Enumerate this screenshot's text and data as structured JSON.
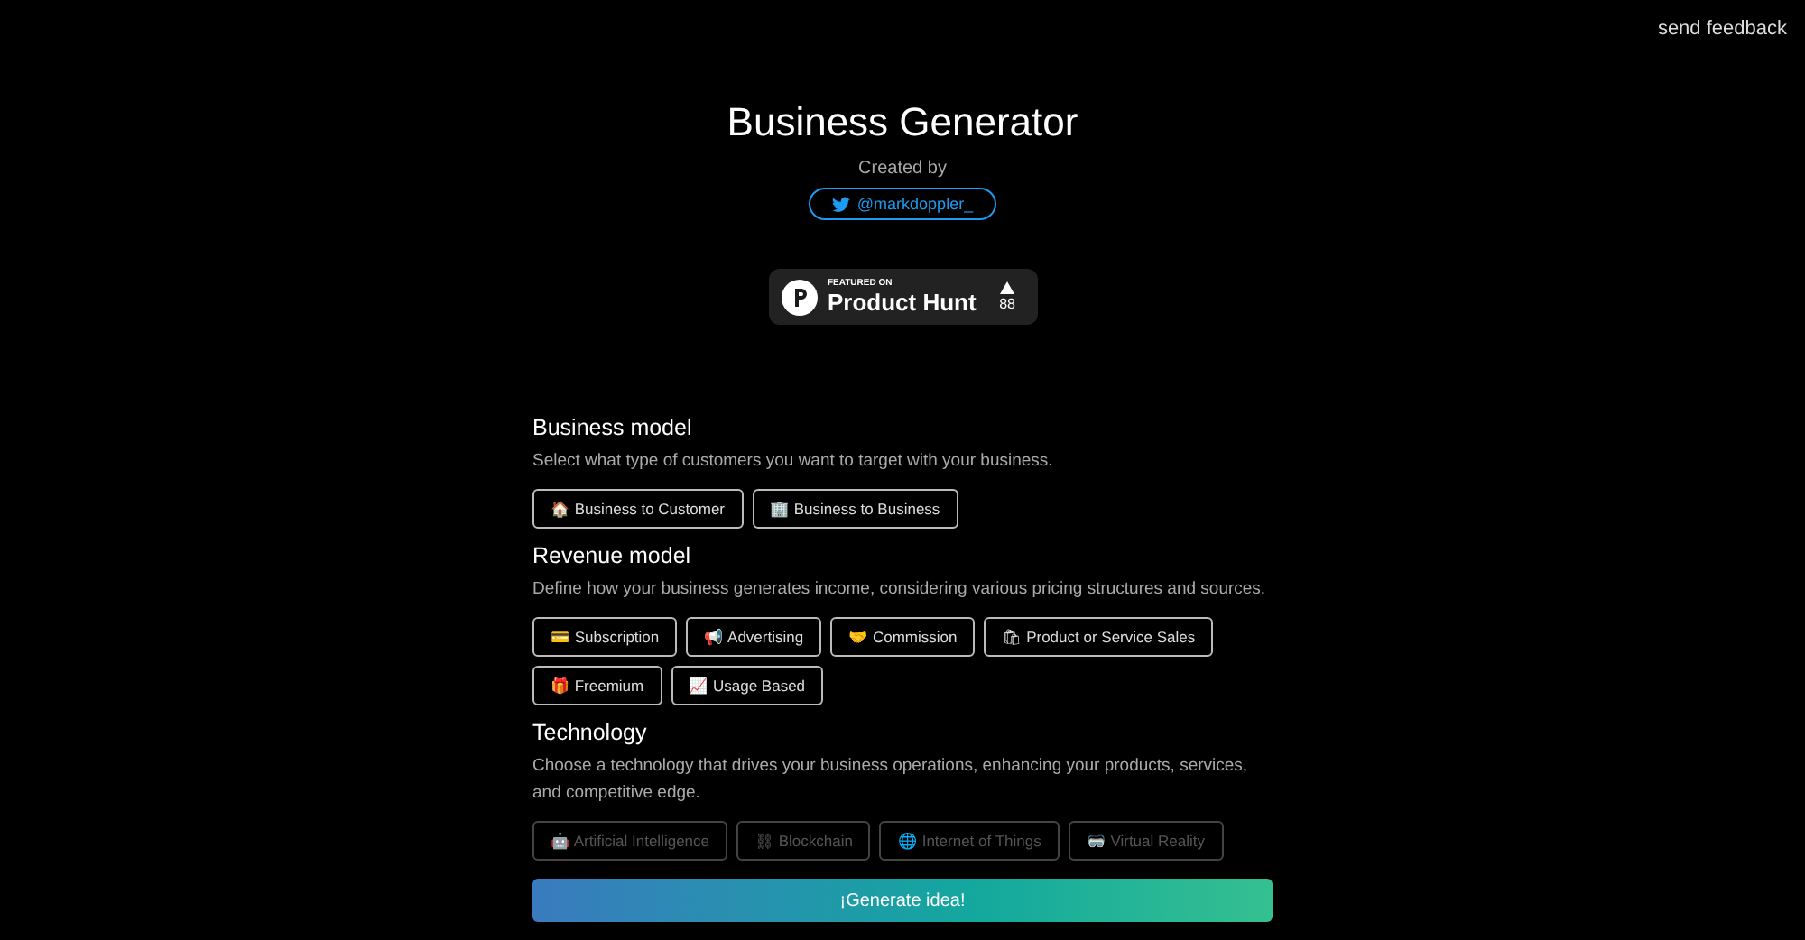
{
  "feedback_link": "send feedback",
  "header": {
    "title": "Business Generator",
    "created_by": "Created by",
    "twitter_handle": "@markdoppler_"
  },
  "product_hunt_badge": {
    "featured_on": "FEATURED ON",
    "name": "Product Hunt",
    "votes": "88"
  },
  "sections": [
    {
      "title": "Business model",
      "description": "Select what type of customers you want to target with your business.",
      "faded": false,
      "options": [
        {
          "icon": "🏠",
          "label": "Business to Customer"
        },
        {
          "icon": "🏢",
          "label": "Business to Business"
        }
      ]
    },
    {
      "title": "Revenue model",
      "description": "Define how your business generates income, considering various pricing structures and sources.",
      "faded": false,
      "options": [
        {
          "icon": "💳",
          "label": "Subscription"
        },
        {
          "icon": "📢",
          "label": "Advertising"
        },
        {
          "icon": "🤝",
          "label": "Commission"
        },
        {
          "icon": "🛍",
          "label": "Product or Service Sales"
        },
        {
          "icon": "🎁",
          "label": "Freemium"
        },
        {
          "icon": "📈",
          "label": "Usage Based"
        }
      ]
    },
    {
      "title": "Technology",
      "description": "Choose a technology that drives your business operations, enhancing your products, services, and competitive edge.",
      "faded": true,
      "options": [
        {
          "icon": "🤖",
          "label": "Artificial Intelligence"
        },
        {
          "icon": "⛓",
          "label": "Blockchain"
        },
        {
          "icon": "🌐",
          "label": "Internet of Things"
        },
        {
          "icon": "🥽",
          "label": "Virtual Reality"
        }
      ]
    }
  ],
  "generate_button": "¡Generate idea!"
}
